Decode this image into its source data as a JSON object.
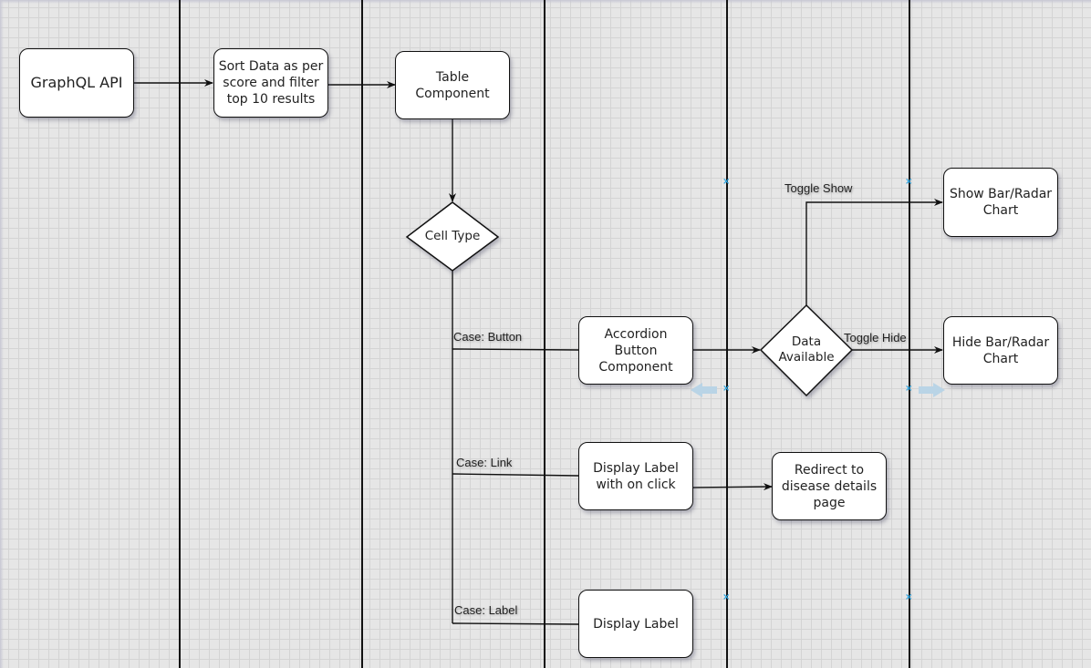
{
  "diagram": {
    "nodes": {
      "graphql_api": "GraphQL API",
      "sort_data": "Sort Data as per score and filter top 10 results",
      "table_component": "Table Component",
      "cell_type": "Cell Type",
      "accordion_button": "Accordion Button Component",
      "data_available": "Data Available",
      "show_chart": "Show Bar/Radar Chart",
      "hide_chart": "Hide Bar/Radar Chart",
      "display_label_click": "Display Label with on click",
      "redirect": "Redirect to disease details page",
      "display_label": "Display Label"
    },
    "edge_labels": {
      "case_button": "Case: Button",
      "case_link": "Case: Link",
      "case_label": "Case: Label",
      "toggle_show": "Toggle Show",
      "toggle_hide": "Toggle Hide"
    },
    "edges": [
      {
        "from": "graphql_api",
        "to": "sort_data"
      },
      {
        "from": "sort_data",
        "to": "table_component"
      },
      {
        "from": "table_component",
        "to": "cell_type"
      },
      {
        "from": "cell_type",
        "to": "accordion_button",
        "label": "Case: Button"
      },
      {
        "from": "cell_type",
        "to": "display_label_click",
        "label": "Case: Link"
      },
      {
        "from": "cell_type",
        "to": "display_label",
        "label": "Case: Label"
      },
      {
        "from": "accordion_button",
        "to": "data_available"
      },
      {
        "from": "data_available",
        "to": "show_chart",
        "label": "Toggle Show"
      },
      {
        "from": "data_available",
        "to": "hide_chart",
        "label": "Toggle Hide"
      },
      {
        "from": "display_label_click",
        "to": "redirect"
      }
    ],
    "colors": {
      "canvas": "#e6e6e6",
      "grid": "#d4d4d4",
      "stroke": "#111111",
      "node_fill": "#ffffff",
      "handle": "#29a3e0"
    }
  }
}
